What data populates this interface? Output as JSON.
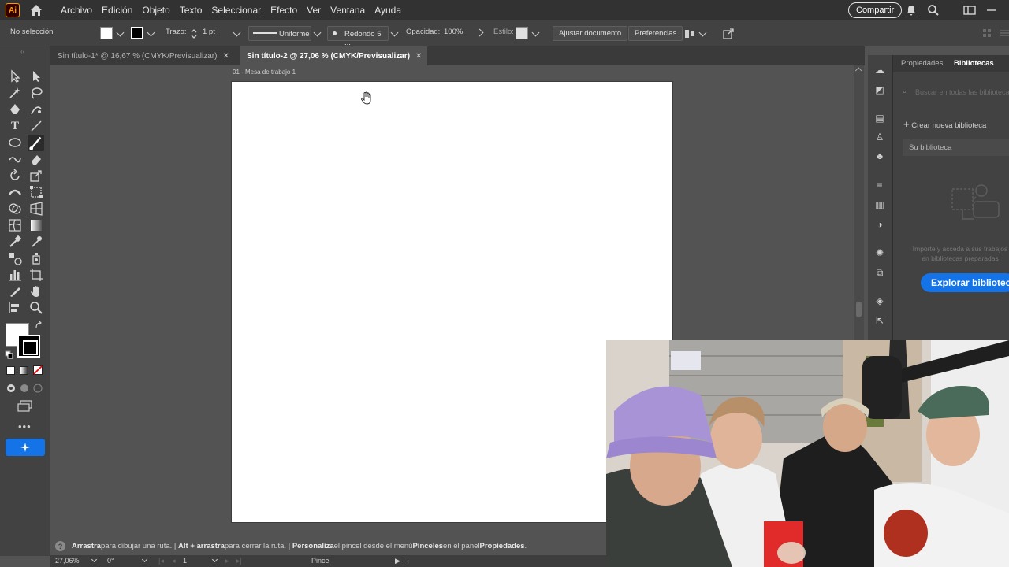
{
  "app": {
    "logo_text": "Ai"
  },
  "menu": [
    "Archivo",
    "Edición",
    "Objeto",
    "Texto",
    "Seleccionar",
    "Efecto",
    "Ver",
    "Ventana",
    "Ayuda"
  ],
  "share_label": "Compartir",
  "control": {
    "selection": "No selección",
    "stroke_label": "Trazo:",
    "stroke_value": "1 pt",
    "stroke_profile": "Uniforme",
    "brush": "Redondo 5 ...",
    "opacity_label": "Opacidad:",
    "opacity_value": "100%",
    "style_label": "Estilo:",
    "fit_doc": "Ajustar documento",
    "prefs": "Preferencias"
  },
  "tabs": [
    {
      "label": "Sin título-1* @ 16,67 % (CMYK/Previsualizar)",
      "active": false
    },
    {
      "label": "Sin título-2 @ 27,06 % (CMYK/Previsualizar)",
      "active": true
    }
  ],
  "artboard_label": "01 - Mesa de trabajo 1",
  "panel": {
    "tab_props": "Propiedades",
    "tab_libs": "Bibliotecas",
    "search_placeholder": "Buscar en todas las bibliotecas",
    "new_library": "Crear nueva biblioteca",
    "your_library": "Su biblioteca",
    "hint": "Importe y acceda a sus trabajos en bibliotecas preparadas",
    "explore": "Explorar bibliotecas"
  },
  "status": {
    "p1b": "Arrastra",
    "p1": " para dibujar una ruta.",
    "p2b": "Alt + arrastra",
    "p2": " para cerrar la ruta.",
    "p3b": "Personaliza",
    "p3": " el pincel desde el menú ",
    "p4b": "Pinceles",
    "p4": " en el panel ",
    "p5b": "Propiedades",
    "p5": "."
  },
  "bottom": {
    "zoom": "27,06%",
    "rotation": "0°",
    "artboard_num": "1",
    "tool": "Pincel"
  },
  "colors": {
    "accent": "#1473e6",
    "logo_orange": "#ff9a00"
  }
}
